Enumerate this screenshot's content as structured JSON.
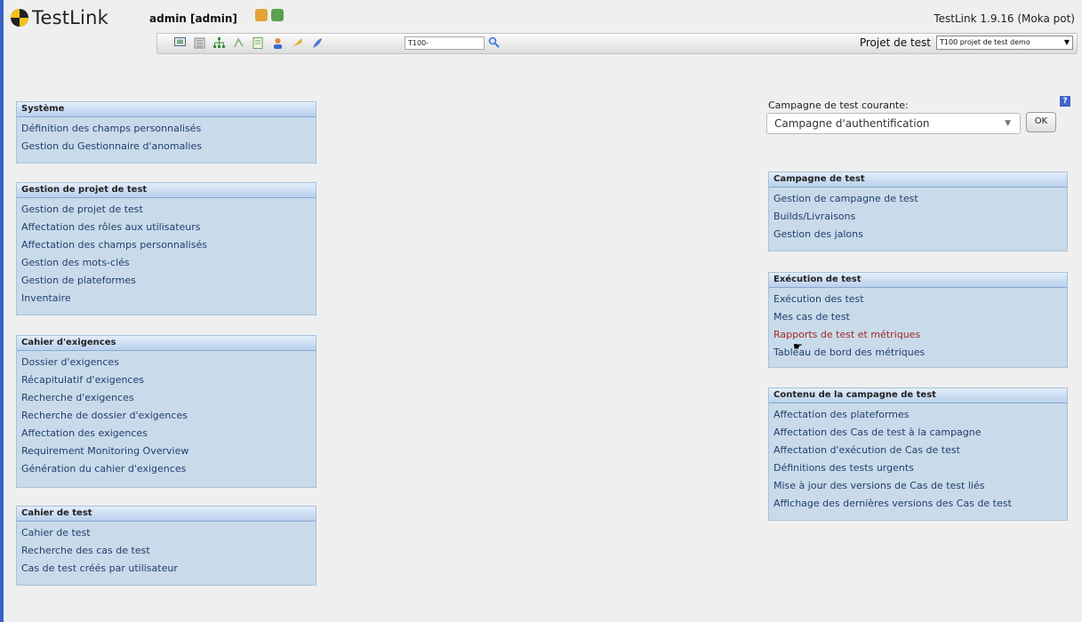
{
  "header": {
    "logo_text": "TestLink",
    "user_label": "admin [admin]",
    "app_version": "TestLink 1.9.16 (Moka pot)",
    "toolbar_icons": [
      "desktop-icon",
      "requirements-icon",
      "tree-icon",
      "testcase-icon",
      "document-icon",
      "users-icon",
      "events-icon",
      "feather-icon"
    ],
    "search_value": "T100-",
    "project_label": "Projet de test",
    "project_value": "T100 projet de test demo"
  },
  "current_plan": {
    "title": "Campagne de test courante:",
    "help_label": "?",
    "select_value": "Campagne d'authentification",
    "ok_label": "OK"
  },
  "left_panels": [
    {
      "title": "Système",
      "items": [
        "Définition des champs personnalisés",
        "Gestion du Gestionnaire d'anomalies"
      ]
    },
    {
      "title": "Gestion de projet de test",
      "items": [
        "Gestion de projet de test",
        "Affectation des rôles aux utilisateurs",
        "Affectation des champs personnalisés",
        "Gestion des mots-clés",
        "Gestion de plateformes",
        "Inventaire"
      ]
    },
    {
      "title": "Cahier d'exigences",
      "items": [
        "Dossier d'exigences",
        "Récapitulatif d'exigences",
        "Recherche d'exigences",
        "Recherche de dossier d'exigences",
        "Affectation des exigences",
        "Requirement Monitoring Overview",
        "Génération du cahier d'exigences"
      ]
    },
    {
      "title": "Cahier de test",
      "items": [
        "Cahier de test",
        "Recherche des cas de test",
        "Cas de test créés par utilisateur"
      ]
    }
  ],
  "right_panels": [
    {
      "title": "Campagne de test",
      "items": [
        "Gestion de campagne de test",
        "Builds/Livraisons",
        "Gestion des jalons"
      ]
    },
    {
      "title": "Exécution de test",
      "items": [
        "Exécution des test",
        "Mes cas de test",
        "Rapports de test et métriques",
        "Tableau de bord des métriques"
      ]
    },
    {
      "title": "Contenu de la campagne de test",
      "items": [
        "Affectation des plateformes",
        "Affectation des Cas de test à la campagne",
        "Affectation d'exécution de Cas de test",
        "Définitions des tests urgents",
        "Mise à jour des versions de Cas de test liés",
        "Affichage des dernières versions des Cas de test"
      ]
    }
  ]
}
